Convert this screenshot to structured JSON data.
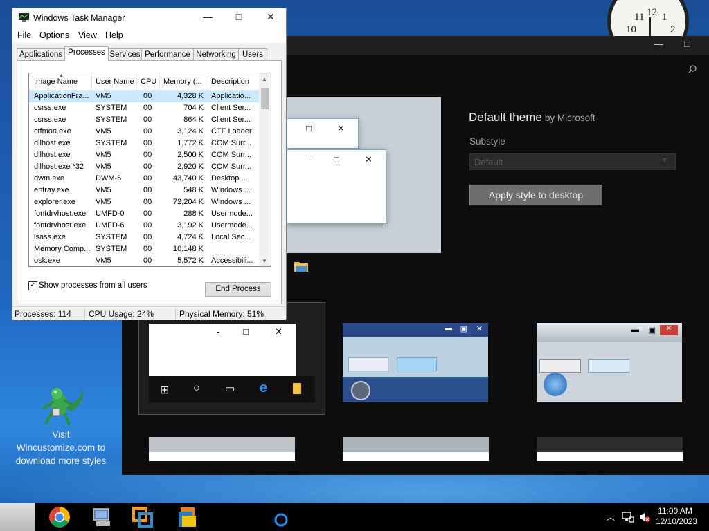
{
  "clock": {
    "numbers": [
      "10",
      "11",
      "12",
      "1",
      "2"
    ]
  },
  "style_app": {
    "window_controls": {
      "minimize": "—",
      "maximize": "□"
    },
    "promo": {
      "line1": "Visit",
      "line2": "Wincustomize.com to",
      "line3": "download more styles"
    },
    "theme": {
      "name": "Default theme",
      "by": "by Microsoft"
    },
    "substyle_label": "Substyle",
    "substyle_value": "Default",
    "apply_button": "Apply style to desktop"
  },
  "taskmgr": {
    "title": "Windows Task Manager",
    "menu": [
      "File",
      "Options",
      "View",
      "Help"
    ],
    "tabs": [
      "Applications",
      "Processes",
      "Services",
      "Performance",
      "Networking",
      "Users"
    ],
    "active_tab": "Processes",
    "columns": [
      "Image Name",
      "User Name",
      "CPU",
      "Memory (...",
      "Description"
    ],
    "rows": [
      [
        "ApplicationFra...",
        "VM5",
        "00",
        "4,328 K",
        "Applicatio..."
      ],
      [
        "csrss.exe",
        "SYSTEM",
        "00",
        "704 K",
        "Client Ser..."
      ],
      [
        "csrss.exe",
        "SYSTEM",
        "00",
        "864 K",
        "Client Ser..."
      ],
      [
        "ctfmon.exe",
        "VM5",
        "00",
        "3,124 K",
        "CTF Loader"
      ],
      [
        "dllhost.exe",
        "SYSTEM",
        "00",
        "1,772 K",
        "COM Surr..."
      ],
      [
        "dllhost.exe",
        "VM5",
        "00",
        "2,500 K",
        "COM Surr..."
      ],
      [
        "dllhost.exe *32",
        "VM5",
        "00",
        "2,920 K",
        "COM Surr..."
      ],
      [
        "dwm.exe",
        "DWM-6",
        "00",
        "43,740 K",
        "Desktop ..."
      ],
      [
        "ehtray.exe",
        "VM5",
        "00",
        "548 K",
        "Windows ..."
      ],
      [
        "explorer.exe",
        "VM5",
        "00",
        "72,204 K",
        "Windows ..."
      ],
      [
        "fontdrvhost.exe",
        "UMFD-0",
        "00",
        "288 K",
        "Usermode..."
      ],
      [
        "fontdrvhost.exe",
        "UMFD-6",
        "00",
        "3,192 K",
        "Usermode..."
      ],
      [
        "lsass.exe",
        "SYSTEM",
        "00",
        "4,724 K",
        "Local Sec..."
      ],
      [
        "Memory Comp...",
        "SYSTEM",
        "00",
        "10,148 K",
        ""
      ],
      [
        "osk.exe",
        "VM5",
        "00",
        "5,572 K",
        "Accessibili..."
      ]
    ],
    "show_all_label": "Show processes from all users",
    "show_all_checked": true,
    "end_process": "End Process",
    "status": {
      "processes": "Processes: 114",
      "cpu": "CPU Usage: 24%",
      "memory": "Physical Memory: 51%"
    }
  },
  "taskbar": {
    "icons": [
      "start-orb-icon",
      "chrome-icon",
      "network-computer-icon",
      "vmware-icon",
      "file-explorer-icon",
      "cortana-icon"
    ],
    "time": "11:00 AM",
    "date": "12/10/2023"
  }
}
